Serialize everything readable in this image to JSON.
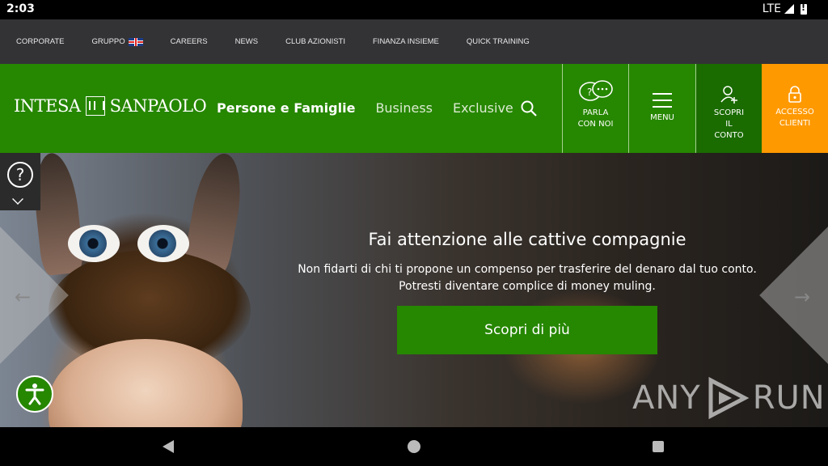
{
  "status_bar": {
    "time": "2:03",
    "network": "LTE"
  },
  "top_nav": {
    "items": [
      {
        "label": "CORPORATE"
      },
      {
        "label": "GRUPPO"
      },
      {
        "label": "CAREERS"
      },
      {
        "label": "NEWS"
      },
      {
        "label": "CLUB AZIONISTI"
      },
      {
        "label": "FINANZA INSIEME"
      },
      {
        "label": "QUICK TRAINING"
      }
    ]
  },
  "main_nav": {
    "logo_left": "INTESA",
    "logo_right": "SANPAOLO",
    "links": [
      {
        "label": "Persone e Famiglie",
        "active": true
      },
      {
        "label": "Business"
      },
      {
        "label": "Exclusive"
      }
    ],
    "buttons": {
      "parla": "PARLA CON NOI",
      "menu": "MENU",
      "scopri": "SCOPRI IL CONTO",
      "accesso": "ACCESSO CLIENTI"
    },
    "colors": {
      "green": "#268700",
      "dark_green": "#1a6b00",
      "orange": "#ff9900"
    }
  },
  "hero": {
    "title": "Fai attenzione alle cattive compagnie",
    "text_line1": "Non fidarti di chi ti propone un compenso per trasferire del denaro dal tuo conto.",
    "text_line2": "Potresti diventare complice di money muling.",
    "cta": "Scopri di più"
  },
  "help": {
    "glyph": "?"
  },
  "watermark": {
    "left": "ANY",
    "right": "RUN"
  }
}
